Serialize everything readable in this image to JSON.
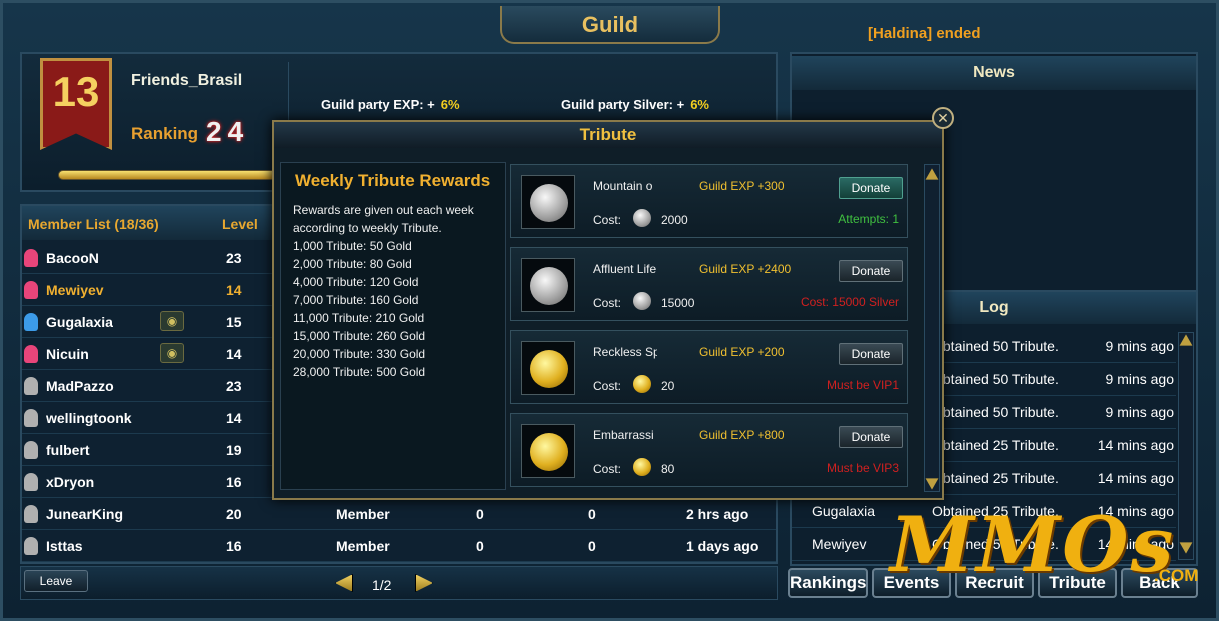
{
  "window": {
    "title": "Guild",
    "notice": "[Haldina] ended"
  },
  "guild": {
    "level": "13",
    "name": "Friends_Brasil",
    "ranking_label": "Ranking",
    "ranking_value": "24",
    "party_exp_label": "Guild party EXP: +",
    "party_exp_value": "6%",
    "party_silver_label": "Guild party Silver: +",
    "party_silver_value": "6%"
  },
  "members": {
    "header": {
      "list": "Member List (18/36)",
      "level": "Level"
    },
    "rows": [
      {
        "name": "BacooN",
        "level": "23",
        "rank": "",
        "c1": "",
        "c2": "",
        "time": "",
        "color": "#e8457a",
        "name_color": "#ffffff"
      },
      {
        "name": "Mewiyev",
        "level": "14",
        "rank": "",
        "c1": "",
        "c2": "",
        "time": "",
        "color": "#e8457a",
        "name_color": "#f0b030"
      },
      {
        "name": "Gugalaxia",
        "level": "15",
        "rank": "",
        "c1": "",
        "c2": "",
        "time": "",
        "color": "#3c9be8",
        "name_color": "#ffffff",
        "eye": "true"
      },
      {
        "name": "Nicuin",
        "level": "14",
        "rank": "",
        "c1": "",
        "c2": "",
        "time": "",
        "color": "#e8457a",
        "name_color": "#ffffff",
        "eye": "true"
      },
      {
        "name": "MadPazzo",
        "level": "23",
        "rank": "",
        "c1": "",
        "c2": "",
        "time": "",
        "color": "#b0b0b0",
        "name_color": "#ffffff"
      },
      {
        "name": "wellingtoonk",
        "level": "14",
        "rank": "",
        "c1": "",
        "c2": "",
        "time": "",
        "color": "#b0b0b0",
        "name_color": "#ffffff"
      },
      {
        "name": "fulbert",
        "level": "19",
        "rank": "",
        "c1": "",
        "c2": "",
        "time": "",
        "color": "#b0b0b0",
        "name_color": "#ffffff"
      },
      {
        "name": "xDryon",
        "level": "16",
        "rank": "",
        "c1": "",
        "c2": "",
        "time": "",
        "color": "#b0b0b0",
        "name_color": "#ffffff"
      },
      {
        "name": "JunearKing",
        "level": "20",
        "rank": "Member",
        "c1": "0",
        "c2": "0",
        "time": "2 hrs ago",
        "color": "#b0b0b0",
        "name_color": "#ffffff"
      },
      {
        "name": "Isttas",
        "level": "16",
        "rank": "Member",
        "c1": "0",
        "c2": "0",
        "time": "1 days ago",
        "color": "#b0b0b0",
        "name_color": "#ffffff"
      }
    ],
    "leave_label": "Leave",
    "page": "1/2",
    "eye_glyph": "◉"
  },
  "news": {
    "title": "News"
  },
  "log": {
    "title": "Log",
    "rows": [
      {
        "who": "",
        "what": "Obtained 50 Tribute.",
        "when": "9 mins ago"
      },
      {
        "who": "",
        "what": "Obtained 50 Tribute.",
        "when": "9 mins ago"
      },
      {
        "who": "",
        "what": "Obtained 50 Tribute.",
        "when": "9 mins ago"
      },
      {
        "who": "",
        "what": "Obtained 25 Tribute.",
        "when": "14 mins ago"
      },
      {
        "who": "",
        "what": "Obtained 25 Tribute.",
        "when": "14 mins ago"
      },
      {
        "who": "Gugalaxia",
        "what": "Obtained 25 Tribute.",
        "when": "14 mins ago"
      },
      {
        "who": "Mewiyev",
        "what": "Obtained 50 Tribute.",
        "when": "14 mins ago"
      }
    ]
  },
  "tabs": [
    "Rankings",
    "Events",
    "Recruit",
    "Tribute",
    "Back"
  ],
  "tribute": {
    "title": "Tribute",
    "close_glyph": "✕",
    "rewards_title": "Weekly Tribute Rewards",
    "rewards_intro": "Rewards are given out each week according to weekly Tribute.",
    "tiers": [
      "1,000 Tribute: 50 Gold",
      "2,000 Tribute: 80 Gold",
      "4,000 Tribute: 120 Gold",
      "7,000 Tribute: 160 Gold",
      "11,000 Tribute: 210 Gold",
      "15,000 Tribute: 260 Gold",
      "20,000 Tribute: 330 Gold",
      "28,000 Tribute: 500 Gold"
    ],
    "items": [
      {
        "name": "Mountain o",
        "exp": "Guild EXP +300",
        "cost_label": "Cost:",
        "cost": "2000",
        "coin": "silver",
        "donate": "Donate",
        "status": "Attempts: 1",
        "status_color": "#40c040",
        "active": true
      },
      {
        "name": "Affluent Life",
        "exp": "Guild EXP +2400",
        "cost_label": "Cost:",
        "cost": "15000",
        "coin": "silver",
        "donate": "Donate",
        "status": "Cost: 15000 Silver",
        "status_color": "#d02020",
        "active": false
      },
      {
        "name": "Reckless Sp",
        "exp": "Guild EXP +200",
        "cost_label": "Cost:",
        "cost": "20",
        "coin": "gold",
        "donate": "Donate",
        "status": "Must be VIP1",
        "status_color": "#d02020",
        "active": false
      },
      {
        "name": "Embarrassi",
        "exp": "Guild EXP +800",
        "cost_label": "Cost:",
        "cost": "80",
        "coin": "gold",
        "donate": "Donate",
        "status": "Must be VIP3",
        "status_color": "#d02020",
        "active": false
      }
    ]
  },
  "watermark": {
    "text": "MMOs",
    "suffix": ".COM"
  }
}
